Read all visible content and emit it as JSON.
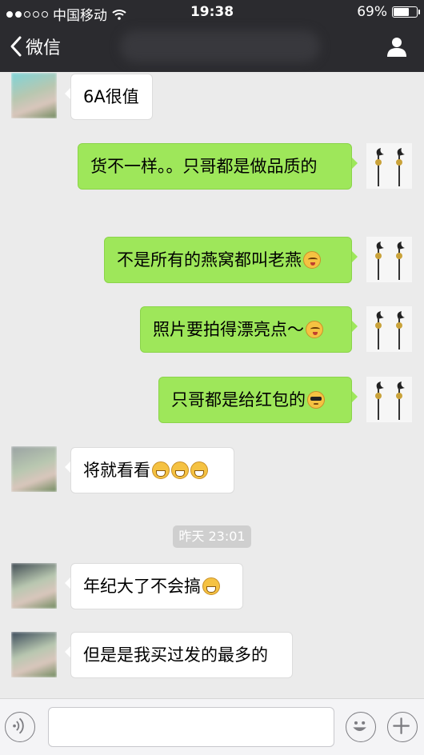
{
  "status_bar": {
    "carrier": "中国移动",
    "time": "19:38",
    "battery": "69%",
    "battery_level": 0.69,
    "signal_bars": 2
  },
  "nav": {
    "back_label": "微信",
    "icons": {
      "back": "chevron-left-icon",
      "profile": "person-icon"
    }
  },
  "messages": [
    {
      "side": "left",
      "text": "6A很值"
    },
    {
      "side": "right",
      "text": "货不一样。。只哥都是做品质的"
    },
    {
      "side": "right",
      "text": "不是所有的燕窝都叫老燕",
      "emoji": [
        "shy"
      ]
    },
    {
      "side": "right",
      "text": "照片要拍得漂亮点～",
      "emoji": [
        "shy"
      ]
    },
    {
      "side": "right",
      "text": "只哥都是给红包的",
      "emoji": [
        "cool"
      ]
    },
    {
      "side": "left",
      "text": "将就看看",
      "emoji": [
        "grin",
        "grin",
        "grin"
      ]
    },
    {
      "side": "left",
      "text": "年纪大了不会搞",
      "emoji": [
        "grin"
      ]
    },
    {
      "side": "left",
      "text": "但是是我买过发的最多的"
    }
  ],
  "timestamp": "昨天 23:01",
  "input_bar": {
    "value": "",
    "icons": {
      "voice": "voice-icon",
      "emoji": "smiley-icon",
      "more": "plus-icon"
    }
  },
  "colors": {
    "bar_bg": "#2b2b2f",
    "chat_bg": "#ebebeb",
    "outgoing_bubble": "#9ee75a",
    "incoming_bubble": "#ffffff"
  }
}
